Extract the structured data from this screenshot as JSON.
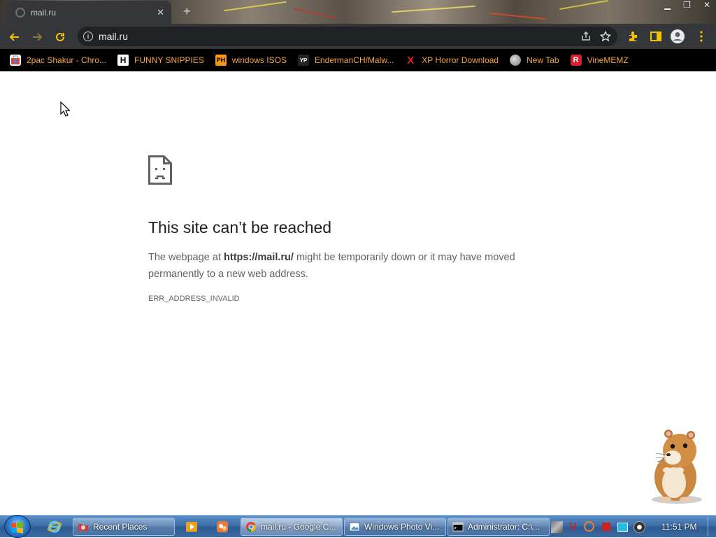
{
  "tab": {
    "title": "mail.ru",
    "new_tab_symbol": "+"
  },
  "window_controls": {
    "minimize": "▁",
    "restore": "❐",
    "close": "✕"
  },
  "omnibox": {
    "url": "mail.ru"
  },
  "bookmarks": [
    {
      "label": "2pac Shakur - Chro...",
      "icon": "chrome-webstore-icon"
    },
    {
      "label": "FUNNY SNIPPIES",
      "icon": "h-letter-icon",
      "icon_text": "H"
    },
    {
      "label": "windows ISOS",
      "icon": "ph-icon",
      "icon_text": "PH"
    },
    {
      "label": "EndermanCH/Malw...",
      "icon": "yp-icon",
      "icon_text": "YP"
    },
    {
      "label": "XP Horror Download",
      "icon": "x-icon",
      "icon_text": "X"
    },
    {
      "label": "New Tab",
      "icon": "globe-icon"
    },
    {
      "label": "VineMEMZ",
      "icon": "r-icon",
      "icon_text": "R"
    }
  ],
  "error": {
    "title": "This site can’t be reached",
    "text_before": "The webpage at ",
    "url": "https://mail.ru/",
    "text_after": " might be temporarily down or it may have moved permanently to a new web address.",
    "code": "ERR_ADDRESS_INVALID"
  },
  "taskbar": {
    "buttons": [
      {
        "label": "Recent Places",
        "icon": "folder-icon"
      },
      {
        "label": "mail.ru - Google C...",
        "icon": "chrome-icon"
      },
      {
        "label": "Windows Photo Vi...",
        "icon": "photo-viewer-icon"
      },
      {
        "label": "Administrator: C:\\...",
        "icon": "cmd-icon"
      }
    ],
    "clock": "11:51 PM"
  },
  "colors": {
    "toolbar": "#35363a",
    "omnibox": "#202124",
    "bookmark_text": "#f3a446",
    "bookmarks_bar": "#000000",
    "extension_icon": "#f2c200"
  }
}
